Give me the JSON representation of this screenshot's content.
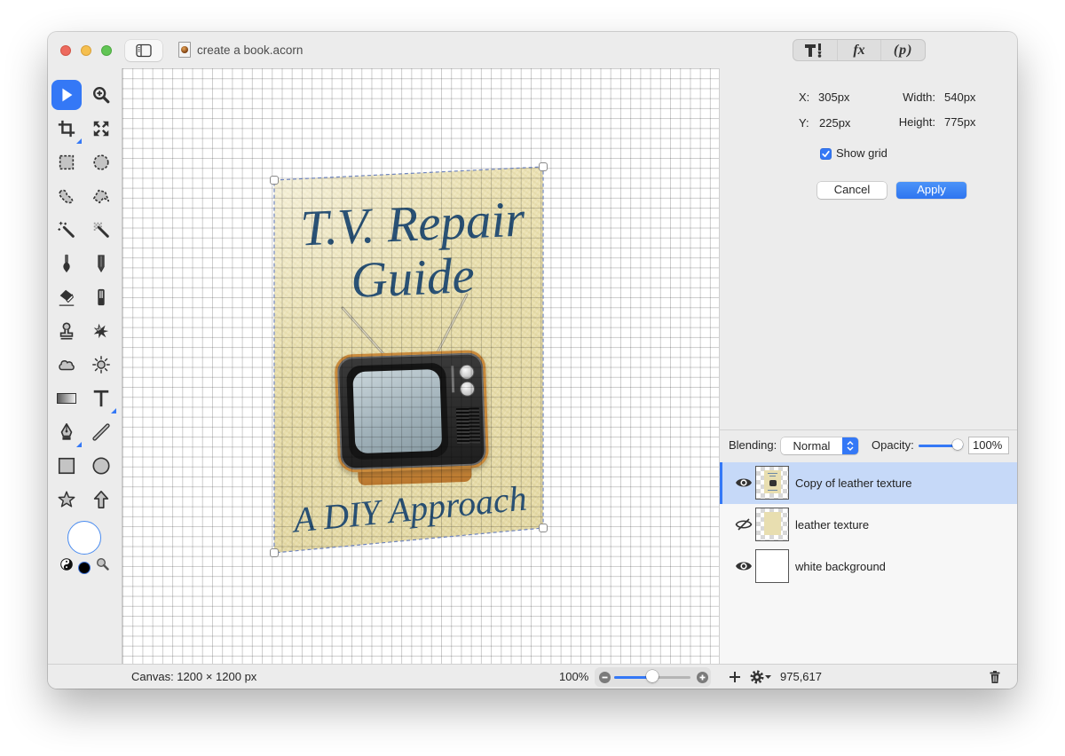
{
  "window": {
    "title": "create a book.acorn"
  },
  "toolbar": {
    "segments": [
      {
        "id": "tools",
        "icon": "hammer-screwdriver-icon",
        "label": ""
      },
      {
        "id": "filters",
        "icon": "fx-icon",
        "label": "fx"
      },
      {
        "id": "properties",
        "icon": "properties-icon",
        "label": "(p)"
      }
    ]
  },
  "tools": [
    {
      "id": "move",
      "icon": "arrow-icon",
      "selected": true
    },
    {
      "id": "zoom",
      "icon": "zoom-in-icon",
      "selected": false
    },
    {
      "id": "crop",
      "icon": "crop-icon",
      "selected": false
    },
    {
      "id": "transform",
      "icon": "transform-arrows-icon",
      "selected": false
    },
    {
      "id": "rect-select",
      "icon": "rect-marquee-icon",
      "selected": false
    },
    {
      "id": "ellipse-select",
      "icon": "ellipse-marquee-icon",
      "selected": false
    },
    {
      "id": "lasso",
      "icon": "lasso-icon",
      "selected": false
    },
    {
      "id": "polygon-lasso",
      "icon": "polygon-lasso-icon",
      "selected": false
    },
    {
      "id": "magic-wand",
      "icon": "magic-wand-icon",
      "selected": false
    },
    {
      "id": "select-color",
      "icon": "color-select-wand-icon",
      "selected": false
    },
    {
      "id": "brush",
      "icon": "brush-icon",
      "selected": false
    },
    {
      "id": "pencil",
      "icon": "pencil-icon",
      "selected": false
    },
    {
      "id": "eraser",
      "icon": "eraser-icon",
      "selected": false
    },
    {
      "id": "fill",
      "icon": "fill-tube-icon",
      "selected": false
    },
    {
      "id": "clone",
      "icon": "clone-stamp-icon",
      "selected": false
    },
    {
      "id": "smudge",
      "icon": "smudge-splat-icon",
      "selected": false
    },
    {
      "id": "burn",
      "icon": "cloud-icon",
      "selected": false
    },
    {
      "id": "dodge",
      "icon": "sun-icon",
      "selected": false
    },
    {
      "id": "gradient",
      "icon": "gradient-icon",
      "selected": false
    },
    {
      "id": "text",
      "icon": "text-icon",
      "selected": false
    },
    {
      "id": "bezier",
      "icon": "pen-nib-icon",
      "selected": false
    },
    {
      "id": "line",
      "icon": "line-icon",
      "selected": false
    },
    {
      "id": "rectangle",
      "icon": "rectangle-shape-icon",
      "selected": false
    },
    {
      "id": "oval",
      "icon": "oval-shape-icon",
      "selected": false
    },
    {
      "id": "star",
      "icon": "star-icon",
      "selected": false
    },
    {
      "id": "arrow-shape",
      "icon": "arrow-up-icon",
      "selected": false
    }
  ],
  "color_well": {
    "foreground": "#ffffff",
    "background": "#000000"
  },
  "canvas": {
    "grid_visible": true,
    "artwork": {
      "title_line1": "T.V. Repair",
      "title_line2": "Guide",
      "subtitle": "A DIY Approach"
    }
  },
  "inspector": {
    "x_label": "X:",
    "x_value": "305px",
    "y_label": "Y:",
    "y_value": "225px",
    "width_label": "Width:",
    "width_value": "540px",
    "height_label": "Height:",
    "height_value": "775px",
    "show_grid_label": "Show grid",
    "show_grid_checked": true,
    "cancel_label": "Cancel",
    "apply_label": "Apply"
  },
  "layers_panel": {
    "blending_label": "Blending:",
    "blending_value": "Normal",
    "opacity_label": "Opacity:",
    "opacity_value": "100%",
    "opacity_fraction": 1.0,
    "layers": [
      {
        "name": "Copy of leather texture",
        "visible": true,
        "selected": true
      },
      {
        "name": "leather texture",
        "visible": false,
        "selected": false
      },
      {
        "name": "white background",
        "visible": true,
        "selected": false
      }
    ]
  },
  "status_bar": {
    "canvas_size": "Canvas: 1200 × 1200 px",
    "zoom_value": "100%",
    "zoom_slider_fraction": 0.5,
    "cursor_position": "975,617"
  },
  "colors": {
    "accent": "#3478f6",
    "selected_row": "#c6d9f8",
    "cover_text": "#2a5276",
    "cover_fill": "#e9dfad"
  }
}
